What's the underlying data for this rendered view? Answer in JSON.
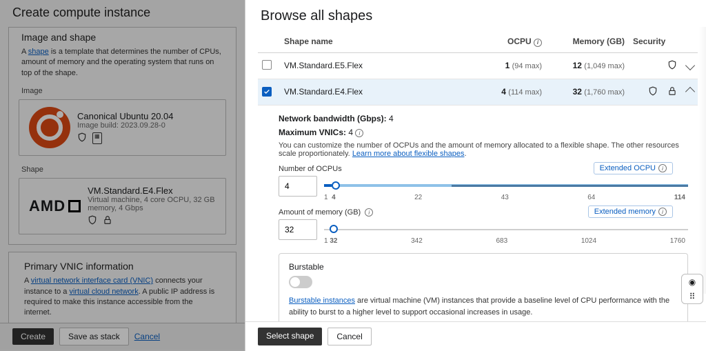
{
  "backdrop": {
    "title": "Create compute instance",
    "section_image_shape": "Image and shape",
    "shape_desc_pre": "A ",
    "shape_desc_link": "shape",
    "shape_desc_post": " is a template that determines the number of CPUs, amount of memory and the operating system that runs on top of the shape.",
    "image_label": "Image",
    "image_name": "Canonical Ubuntu 20.04",
    "image_build": "Image build: 2023.09.28-0",
    "shape_label": "Shape",
    "shape_name": "VM.Standard.E4.Flex",
    "shape_sub": "Virtual machine, 4 core OCPU, 32 GB memory, 4 Gbps",
    "vnic_header": "Primary VNIC information",
    "vnic_text_pre": "A ",
    "vnic_link1": "virtual network interface card (VNIC)",
    "vnic_text_mid": " connects your instance to a ",
    "vnic_link2": "virtual cloud network",
    "vnic_text_post": " A public IP address is required to make this instance accessible from the internet.",
    "create_btn": "Create",
    "save_btn": "Save as stack",
    "cancel_link": "Cancel"
  },
  "drawer": {
    "title": "Browse all shapes",
    "cols": {
      "name": "Shape name",
      "ocpu": "OCPU",
      "memory": "Memory (GB)",
      "security": "Security"
    },
    "shapes": [
      {
        "name": "VM.Standard.E5.Flex",
        "ocpu": "1",
        "ocpu_max": "(94 max)",
        "mem": "12",
        "mem_max": "(1,049 max)",
        "selected": false,
        "shield": true,
        "lock": false,
        "expanded": false
      },
      {
        "name": "VM.Standard.E4.Flex",
        "ocpu": "4",
        "ocpu_max": "(114 max)",
        "mem": "32",
        "mem_max": "(1,760 max)",
        "selected": true,
        "shield": true,
        "lock": true,
        "expanded": true
      }
    ],
    "detail": {
      "bandwidth_label": "Network bandwidth (Gbps):",
      "bandwidth_val": "4",
      "maxvnic_label": "Maximum VNICs:",
      "maxvnic_val": "4",
      "help_text": "You can customize the number of OCPUs and the amount of memory allocated to a flexible shape. The other resources scale proportionately.",
      "help_link": "Learn more about flexible shapes",
      "ocpu_label": "Number of OCPUs",
      "ocpu_value": "4",
      "ocpu_pill": "Extended OCPU",
      "ocpu_ticks": [
        "1",
        "4",
        "22",
        "43",
        "64",
        "114"
      ],
      "mem_label": "Amount of memory (GB)",
      "mem_value": "32",
      "mem_pill": "Extended memory",
      "mem_ticks": [
        "1",
        "32",
        "342",
        "683",
        "1024",
        "1760"
      ],
      "burstable_label": "Burstable",
      "burst_link": "Burstable instances",
      "burst_text": " are virtual machine (VM) instances that provide a baseline level of CPU performance with the ability to burst to a higher level to support occasional increases in usage."
    },
    "select_btn": "Select shape",
    "cancel_btn": "Cancel"
  }
}
